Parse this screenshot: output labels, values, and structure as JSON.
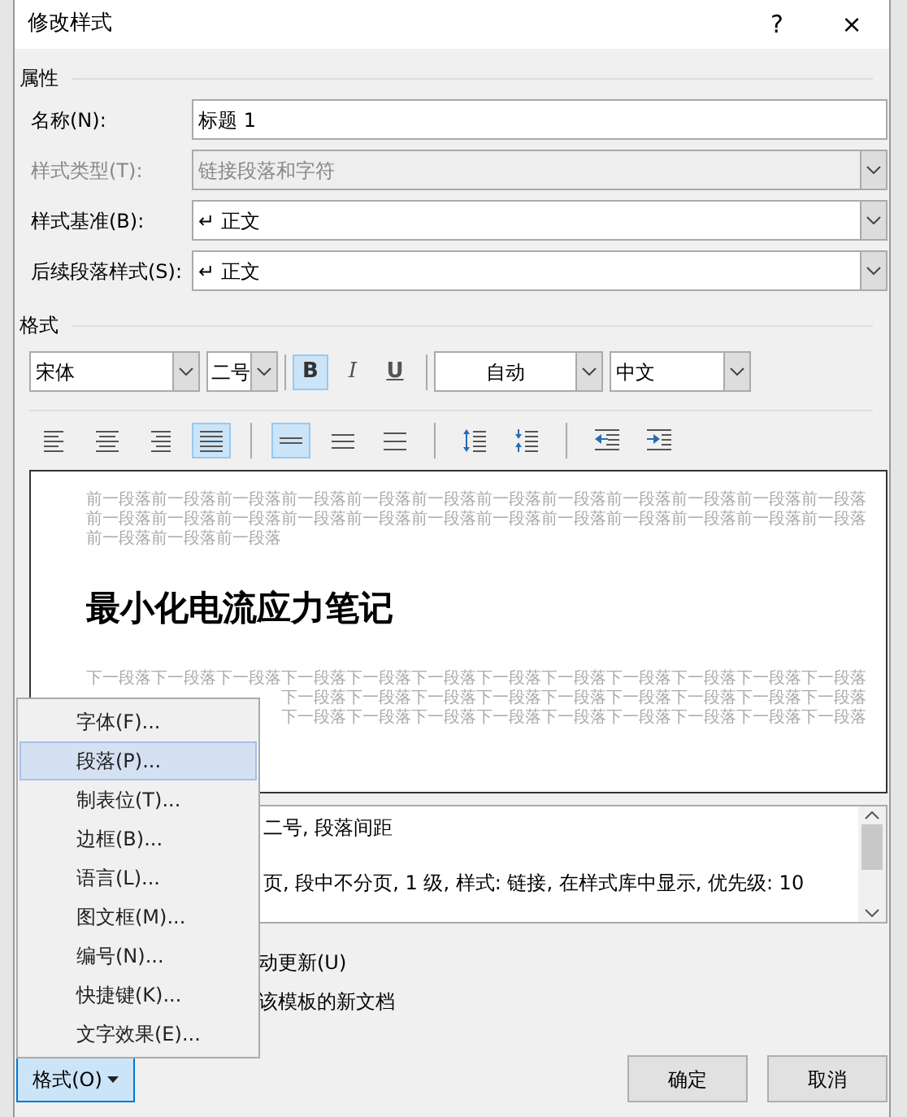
{
  "window": {
    "title": "修改样式",
    "help": "?",
    "close": "×"
  },
  "properties": {
    "heading": "属性",
    "fields": [
      {
        "label": "名称(N):",
        "value": "标题 1",
        "kind": "text",
        "disabled": false
      },
      {
        "label": "样式类型(T):",
        "value": "链接段落和字符",
        "kind": "select",
        "disabled": true
      },
      {
        "label": "样式基准(B):",
        "value": "↵ 正文",
        "kind": "select",
        "disabled": false
      },
      {
        "label": "后续段落样式(S):",
        "value": "↵ 正文",
        "kind": "select",
        "disabled": false
      }
    ]
  },
  "format": {
    "heading": "格式",
    "font": "宋体",
    "size": "二号",
    "font_color_label": "自动",
    "script": "中文",
    "styles": [
      {
        "kind": "bold",
        "label": "B",
        "selected": true
      },
      {
        "kind": "italic",
        "label": "I",
        "selected": false
      },
      {
        "kind": "underline",
        "label": "U",
        "selected": false
      }
    ],
    "tool_groups": [
      [
        {
          "kind": "align-left",
          "selected": false
        },
        {
          "kind": "align-center",
          "selected": false
        },
        {
          "kind": "align-right",
          "selected": false
        },
        {
          "kind": "justify",
          "selected": true
        }
      ],
      [
        {
          "kind": "single-spacing",
          "selected": true
        },
        {
          "kind": "one-half-spacing",
          "selected": false
        },
        {
          "kind": "double-spacing",
          "selected": false
        }
      ],
      [
        {
          "kind": "space-increase",
          "selected": false
        },
        {
          "kind": "space-decrease",
          "selected": false
        }
      ],
      [
        {
          "kind": "indent-decrease",
          "selected": false
        },
        {
          "kind": "indent-increase",
          "selected": false
        }
      ]
    ]
  },
  "preview": {
    "before_lines": [
      "前一段落前一段落前一段落前一段落前一段落前一段落前一段落前一段落前一段落前一段落前一段落前一段落",
      "前一段落前一段落前一段落前一段落前一段落前一段落前一段落前一段落前一段落前一段落前一段落前一段落",
      "前一段落前一段落前一段落"
    ],
    "heading": "最小化电流应力笔记",
    "after_lines": [
      "下一段落下一段落下一段落下一段落下一段落下一段落下一段落下一段落下一段落下一段落下一段落下一段落",
      "下一段落下一段落下一段落下一段落下一段落下一段落下一段落下一段落下一段落",
      "下一段落下一段落下一段落下一段落下一段落下一段落下一段落下一段落下一段落"
    ]
  },
  "description": {
    "lines": [
      "二号, 段落间距",
      "页, 段中不分页, 1 级, 样式: 链接, 在样式库中显示, 优先级: 10"
    ]
  },
  "options": [
    {
      "label": "动更新(U)"
    },
    {
      "label": "该模板的新文档"
    }
  ],
  "menu": {
    "items": [
      {
        "label": "字体(F)...",
        "selected": false
      },
      {
        "label": "段落(P)...",
        "selected": true
      },
      {
        "label": "制表位(T)...",
        "selected": false
      },
      {
        "label": "边框(B)...",
        "selected": false
      },
      {
        "label": "语言(L)...",
        "selected": false
      },
      {
        "label": "图文框(M)...",
        "selected": false
      },
      {
        "label": "编号(N)...",
        "selected": false
      },
      {
        "label": "快捷键(K)...",
        "selected": false
      },
      {
        "label": "文字效果(E)...",
        "selected": false
      }
    ]
  },
  "format_button": {
    "label": "格式(O)",
    "expanded": true
  },
  "buttons": [
    "确定",
    "取消"
  ]
}
